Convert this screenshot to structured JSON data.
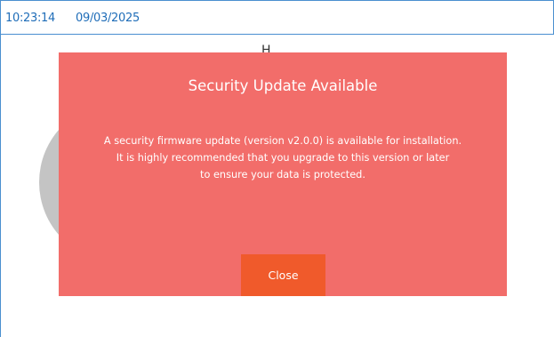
{
  "status_bar": {
    "time": "10:23:14",
    "date": "09/03/2025"
  },
  "background": {
    "partial_text": "H"
  },
  "dialog": {
    "title": "Security Update Available",
    "message": "A security firmware update (version v2.0.0) is available for installation.\nIt is highly recommended that you upgrade to this version or later\nto ensure your data is protected.",
    "close_label": "Close",
    "background_color": "#f26d6a",
    "button_color": "#f05a2b"
  },
  "colors": {
    "accent": "#1f6db8",
    "border": "#4a8fd0",
    "gauge": "#c4c4c4"
  }
}
